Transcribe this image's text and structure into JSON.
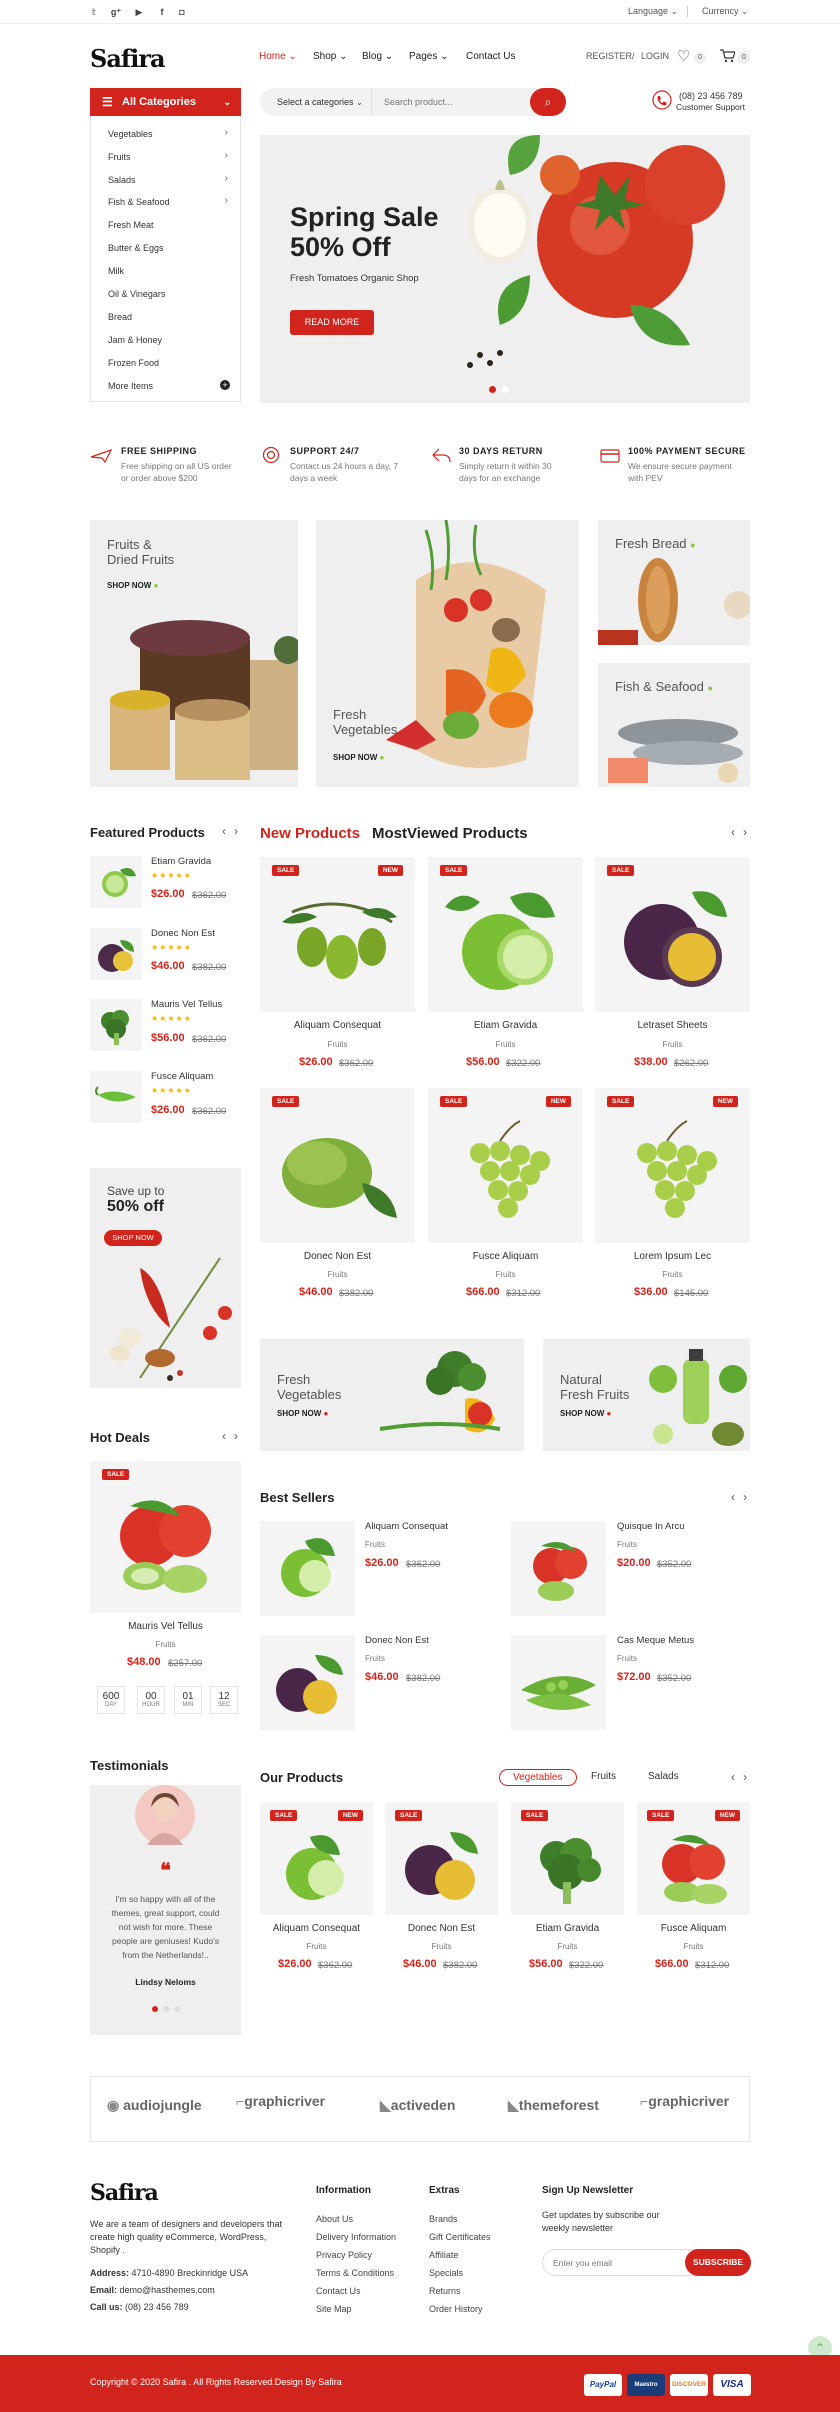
{
  "topbar": {
    "social": [
      "twitter-icon",
      "google-plus-icon",
      "youtube-icon",
      "facebook-icon",
      "instagram-icon"
    ],
    "language": "Language",
    "currency": "Currency"
  },
  "header": {
    "logo": "Safira",
    "nav": [
      "Home",
      "Shop",
      "Blog",
      "Pages",
      "Contact Us"
    ],
    "register": "REGISTER",
    "sep": "/",
    "login": "LOGIN",
    "wishlist_count": "0",
    "cart_count": "0",
    "phone": "(08) 23 456 789",
    "support": "Customer Support"
  },
  "categories": {
    "title": "All Categories",
    "items": [
      "Vegetables",
      "Fruits",
      "Salads",
      "Fish & Seafood",
      "Fresh Meat",
      "Butter & Eggs",
      "Milk",
      "Oil & Vinegars",
      "Bread",
      "Jam & Honey",
      "Frozen Food",
      "More Items"
    ]
  },
  "search": {
    "select": "Select a categories",
    "placeholder": "Search product..."
  },
  "hero": {
    "title1": "Spring Sale",
    "title2": "50% Off",
    "subtitle": "Fresh Tomatoes Organic Shop",
    "button": "READ MORE"
  },
  "services": [
    {
      "title": "FREE SHIPPING",
      "desc1": "Free shipping on all US order",
      "desc2": "or order above $200"
    },
    {
      "title": "SUPPORT 24/7",
      "desc1": "Contact us 24 hours a day, 7",
      "desc2": "days a week"
    },
    {
      "title": "30 DAYS RETURN",
      "desc1": "Simply return it within 30",
      "desc2": "days for an exchange"
    },
    {
      "title": "100% PAYMENT SECURE",
      "desc1": "We ensure secure payment",
      "desc2": "with PEV"
    }
  ],
  "banners": {
    "b1a": "Fruits &",
    "b1b": "Dried Fruits",
    "b2a": "Fresh",
    "b2b": "Vegetables",
    "b3": "Fresh Bread",
    "b4": "Fish & Seafood",
    "shop": "SHOP NOW"
  },
  "featured": {
    "title": "Featured Products",
    "items": [
      {
        "name": "Etiam Gravida",
        "price": "$26.00",
        "old": "$362.00"
      },
      {
        "name": "Donec Non Est",
        "price": "$46.00",
        "old": "$382.00"
      },
      {
        "name": "Mauris Vel Tellus",
        "price": "$56.00",
        "old": "$362.00"
      },
      {
        "name": "Fusce Aliquam",
        "price": "$26.00",
        "old": "$362.00"
      }
    ],
    "stars": "★★★★★"
  },
  "promo": {
    "line1": "Save up to",
    "line2": "50% off",
    "button": "SHOP NOW"
  },
  "newproducts": {
    "tab1": "New Products",
    "tab2": "MostViewed Products",
    "items": [
      {
        "name": "Aliquam Consequat",
        "cat": "Fruits",
        "price": "$26.00",
        "old": "$362.00",
        "sale": "SALE",
        "new": "NEW"
      },
      {
        "name": "Etiam Gravida",
        "cat": "Fruits",
        "price": "$56.00",
        "old": "$322.00",
        "sale": "SALE"
      },
      {
        "name": "Letraset Sheets",
        "cat": "Fruits",
        "price": "$38.00",
        "old": "$262.00",
        "sale": "SALE"
      },
      {
        "name": "Donec Non Est",
        "cat": "Fruits",
        "price": "$46.00",
        "old": "$382.00",
        "sale": "SALE"
      },
      {
        "name": "Fusce Aliquam",
        "cat": "Fruits",
        "price": "$66.00",
        "old": "$312.00",
        "sale": "SALE",
        "new": "NEW"
      },
      {
        "name": "Lorem Ipsum Lec",
        "cat": "Fruits",
        "price": "$36.00",
        "old": "$145.00",
        "sale": "SALE",
        "new": "NEW"
      }
    ]
  },
  "midbanners": {
    "a1": "Fresh",
    "a2": "Vegetables",
    "b1": "Natural",
    "b2": "Fresh Fruits",
    "shop": "SHOP NOW"
  },
  "hotdeals": {
    "title": "Hot Deals",
    "sale": "SALE",
    "name": "Mauris Vel Tellus",
    "cat": "Fruits",
    "price": "$48.00",
    "old": "$257.00",
    "timer": [
      {
        "v": "600",
        "l": "DAY"
      },
      {
        "v": "00",
        "l": "HOUR"
      },
      {
        "v": "01",
        "l": "MIN"
      },
      {
        "v": "12",
        "l": "SEC"
      }
    ]
  },
  "bestsellers": {
    "title": "Best Sellers",
    "items": [
      {
        "name": "Aliquam Consequat",
        "cat": "Fruits",
        "price": "$26.00",
        "old": "$362.00"
      },
      {
        "name": "Quisque In Arcu",
        "cat": "Fruits",
        "price": "$20.00",
        "old": "$352.00"
      },
      {
        "name": "Donec Non Est",
        "cat": "Fruits",
        "price": "$46.00",
        "old": "$382.00"
      },
      {
        "name": "Cas Meque Metus",
        "cat": "Fruits",
        "price": "$72.00",
        "old": "$352.00"
      }
    ]
  },
  "testimonials": {
    "title": "Testimonials",
    "quote": "I'm so happy with all of the themes, great support, could not wish for more. These people are geniuses! Kudo's from the Netherlands!..",
    "q1": "I'm so happy with all of the",
    "q2": "themes, great support, could",
    "q3": "not wish for more. These",
    "q4": "people are geniuses! Kudo's",
    "q5": "from the Netherlands!..",
    "author": "Lindsy Neloms"
  },
  "ourproducts": {
    "title": "Our Products",
    "tabs": [
      "Vegetables",
      "Fruits",
      "Salads"
    ],
    "items": [
      {
        "name": "Aliquam Consequat",
        "cat": "Fruits",
        "price": "$26.00",
        "old": "$362.00",
        "sale": "SALE",
        "new": "NEW"
      },
      {
        "name": "Donec Non Est",
        "cat": "Fruits",
        "price": "$46.00",
        "old": "$382.00",
        "sale": "SALE"
      },
      {
        "name": "Etiam Gravida",
        "cat": "Fruits",
        "price": "$56.00",
        "old": "$322.00",
        "sale": "SALE"
      },
      {
        "name": "Fusce Aliquam",
        "cat": "Fruits",
        "price": "$66.00",
        "old": "$312.00",
        "sale": "SALE",
        "new": "NEW"
      }
    ]
  },
  "brands": [
    "audiojungle",
    "graphicriver",
    "activeden",
    "themeforest",
    "graphicriver"
  ],
  "footer": {
    "logo": "Safira",
    "about1": "We are a team of designers and developers that",
    "about2": "create high quality eCommerce, WordPress,",
    "about3": "Shopify .",
    "addr_l": "Address:",
    "addr": "4710-4890 Breckinridge USA",
    "email_l": "Email:",
    "email": "demo@hasthemes.com",
    "call_l": "Call us:",
    "call": "(08) 23 456 789",
    "info_title": "Information",
    "info": [
      "About Us",
      "Delivery Information",
      "Privacy Policy",
      "Terms & Conditions",
      "Contact Us",
      "Site Map"
    ],
    "extras_title": "Extras",
    "extras": [
      "Brands",
      "Gift Certificates",
      "Affiliate",
      "Specials",
      "Returns",
      "Order History"
    ],
    "news_title": "Sign Up Newsletter",
    "news1": "Get updates by subscribe our",
    "news2": "weekly newsletter",
    "news_placeholder": "Enter you email",
    "subscribe": "SUBSCRIBE",
    "copyright": "Copyright © 2020 Safira . All Rights Reserved.Design By Safira",
    "payments": [
      "PayPal",
      "Maestro",
      "DISCOVER",
      "VISA"
    ]
  },
  "colors": {
    "accent": "#d0241c",
    "bg_gray": "#f4f4f4",
    "star": "#f5b400"
  }
}
